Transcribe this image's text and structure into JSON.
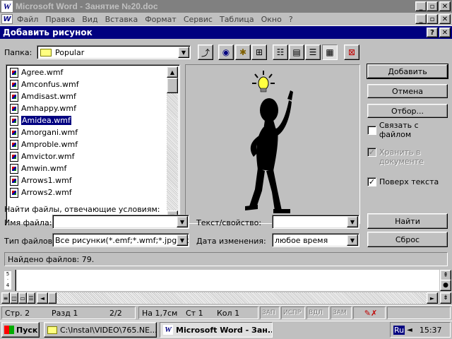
{
  "word": {
    "title": "Microsoft Word - Занятие №20.doc",
    "menu": [
      "Файл",
      "Правка",
      "Вид",
      "Вставка",
      "Формат",
      "Сервис",
      "Таблица",
      "Окно",
      "?"
    ]
  },
  "dialog": {
    "title": "Добавить рисунок",
    "folder_label": "Папка:",
    "folder_value": "Popular",
    "files": [
      "Agree.wmf",
      "Amconfus.wmf",
      "Amdisast.wmf",
      "Amhappy.wmf",
      "Amidea.wmf",
      "Amorgani.wmf",
      "Amproble.wmf",
      "Amvictor.wmf",
      "Amwin.wmf",
      "Arrows1.wmf",
      "Arrows2.wmf"
    ],
    "selected_file": "Amidea.wmf",
    "buttons": {
      "add": "Добавить",
      "cancel": "Отмена",
      "filter": "Отбор...",
      "find": "Найти",
      "reset": "Сброс"
    },
    "checkboxes": {
      "link": {
        "label": "Связать с файлом",
        "checked": false
      },
      "store": {
        "label_line1": "Хранить в",
        "label_line2": "документе",
        "checked": true,
        "disabled": true
      },
      "float": {
        "label": "Поверх текста",
        "checked": true
      }
    },
    "search_header": "Найти файлы, отвечающие условиям:",
    "filename_label": "Имя файла:",
    "filename_value": "",
    "filetype_label": "Тип файлов:",
    "filetype_value": "Все рисунки(*.emf;*.wmf;*.jpg;*.p",
    "text_label": "Текст/свойство:",
    "text_value": "",
    "date_label": "Дата изменения:",
    "date_value": "любое время",
    "found_text": "Найдено файлов: 79."
  },
  "statusbar": {
    "page": "Стр. 2",
    "section": "Разд 1",
    "pages": "2/2",
    "at": "На 1,7см",
    "line": "Ст 1",
    "col": "Кол 1",
    "rec": "ЗАП",
    "trk": "ИСПР",
    "ext": "ВДЛ",
    "ovr": "ЗАМ"
  },
  "taskbar": {
    "start": "Пуск",
    "task1": "C:\\Instal\\VIDEO\\765.NE...",
    "task2": "Microsoft Word - Зан...",
    "lang": "Ru",
    "clock": "15:37"
  },
  "colors": {
    "active_title": "#000080",
    "inactive_title": "#808080",
    "face": "#c0c0c0"
  },
  "icons": {
    "word_logo": "word-logo-icon",
    "folder": "folder-icon",
    "up_folder": "up-folder-icon",
    "web_search": "web-search-icon",
    "favorites": "favorites-icon",
    "add_favorites": "add-to-favorites-icon",
    "list_view": "list-view-icon",
    "details_view": "details-view-icon",
    "properties_view": "properties-view-icon",
    "preview_view": "preview-view-icon",
    "commands": "commands-icon"
  }
}
